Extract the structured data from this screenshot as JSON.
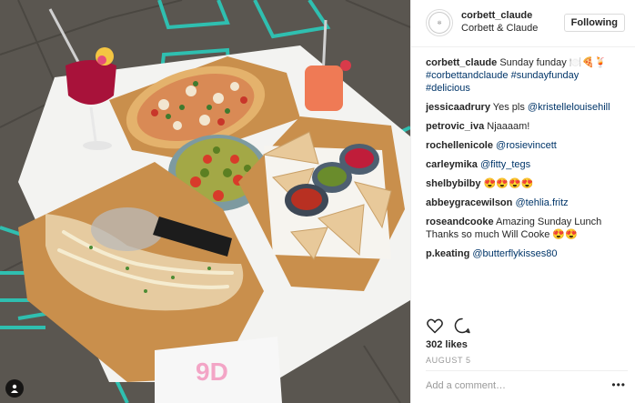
{
  "header": {
    "username": "corbett_claude",
    "location": "Corbett & Claude",
    "follow_label": "Following"
  },
  "caption": {
    "username": "corbett_claude",
    "text": "Sunday funday 🍽️🍕🍹",
    "hashtags": [
      "#corbettandclaude",
      "#sundayfunday",
      "#delicious"
    ]
  },
  "comments": [
    {
      "username": "jessicaadrury",
      "text": "Yes pls ",
      "mention": "@kristellelouisehill"
    },
    {
      "username": "petrovic_iva",
      "text": "Njaaaam!",
      "mention": ""
    },
    {
      "username": "rochellenicole",
      "text": "",
      "mention": "@rosievincett"
    },
    {
      "username": "carleymika",
      "text": "",
      "mention": "@fitty_tegs"
    },
    {
      "username": "shelbybilby",
      "text": "😍😍😍😍",
      "mention": ""
    },
    {
      "username": "abbeygracewilson",
      "text": "",
      "mention": "@tehlia.fritz"
    },
    {
      "username": "roseandcooke",
      "text": "Amazing Sunday Lunch Thanks so much Will Cooke 😍😍",
      "mention": ""
    },
    {
      "username": "p.keating",
      "text": "",
      "mention": "@butterflykisses80"
    }
  ],
  "stats": {
    "likes": "302 likes",
    "date": "AUGUST 5"
  },
  "comment_box": {
    "placeholder": "Add a comment…",
    "more": "•••"
  },
  "photo": {
    "dish_names": [
      "pizza",
      "calzone",
      "flatbread",
      "salad",
      "dips",
      "cocktails"
    ],
    "watermark": "9D"
  },
  "icons": {
    "like": "heart-icon",
    "comment": "comment-icon",
    "user_tag": "user-tag-icon",
    "avatar": "brand-logo-icon"
  },
  "colors": {
    "link": "#003569",
    "text": "#262626",
    "muted": "#999999",
    "border": "#dbdbdb"
  }
}
